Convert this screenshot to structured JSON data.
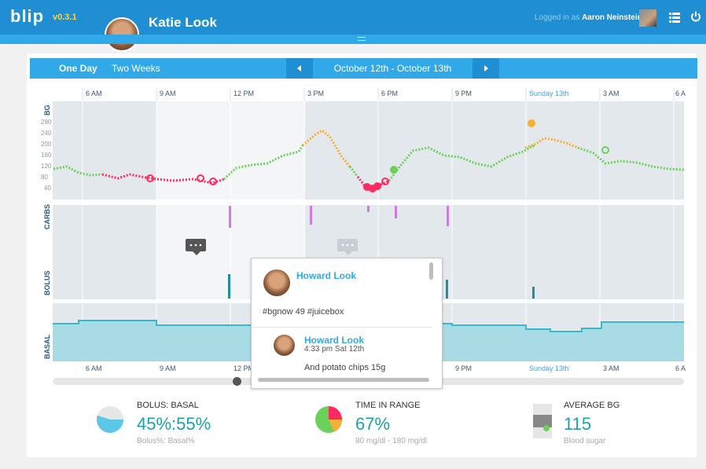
{
  "header": {
    "logo": "blip",
    "version": "v0.3.1",
    "patient_name": "Katie Look",
    "logged_in_prefix": "Logged in as",
    "logged_in_user": "Aaron Neinstein",
    "icons": [
      "menu-icon",
      "power-icon"
    ]
  },
  "nav": {
    "tabs": [
      "One Day",
      "Two Weeks"
    ],
    "active_tab": "One Day",
    "date_range": "October 12th - October 13th",
    "prev_icon": "triangle-left-icon",
    "next_icon": "triangle-right-icon"
  },
  "timeline": {
    "ticks": [
      "6 AM",
      "9 AM",
      "12 PM",
      "3 PM",
      "6 PM",
      "9 PM",
      "Sunday 13th",
      "3 AM",
      "6 A"
    ],
    "rows": [
      "BG",
      "CARBS",
      "BOLUS",
      "BASAL"
    ],
    "bg_axis": [
      280,
      240,
      200,
      160,
      120,
      80,
      40
    ]
  },
  "tooltip": {
    "author": "Howard Look",
    "message": "#bgnow 49 #juicebox",
    "reply_author": "Howard Look",
    "reply_time": "4:33 pm Sat 12th",
    "reply_text": "And potato chips 15g"
  },
  "stats": {
    "bolus_basal": {
      "title": "BOLUS: BASAL",
      "value": "45%:55%",
      "sub": "Bolus%: Basal%",
      "bolus_pct": 45,
      "basal_pct": 55
    },
    "time_in_range": {
      "title": "TIME IN RANGE",
      "value": "67%",
      "sub": "80 mg/dl - 180 mg/dl",
      "in_pct": 67
    },
    "average_bg": {
      "title": "AVERAGE BG",
      "value": "115",
      "sub": "Blood sugar"
    }
  },
  "colors": {
    "brand": "#1f8ed2",
    "accent": "#31a8e8",
    "bg_low": "#ff2a5f",
    "bg_target": "#6cd15a",
    "bg_high": "#f7b036",
    "carbs": "#c77ee0",
    "bolus": "#1c8f99",
    "basal": "#5ec8d6",
    "stat_value": "#1fa0a8"
  }
}
